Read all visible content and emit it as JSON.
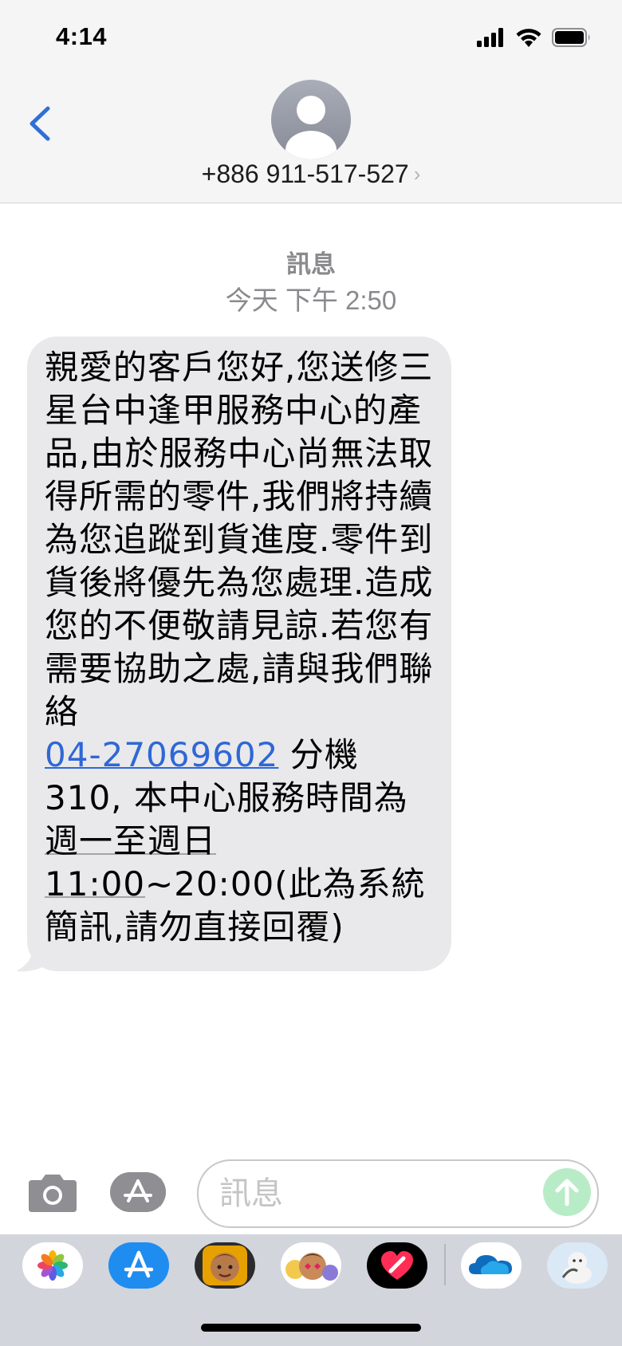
{
  "status_bar": {
    "time": "4:14"
  },
  "header": {
    "contact": "+886 911-517-527",
    "chevron": "›"
  },
  "thread": {
    "service_label": "訊息",
    "date_label": "今天 下午 2:50"
  },
  "message": {
    "part1": "親愛的客戶您好,您送修三星台中逢甲服務中心的產品,由於服務中心尚無法取得所需的零件,我們將持續為您追蹤到貨進度.零件到貨後將優先為您處理.造成您的不便敬請見諒.若您有需要協助之處,請與我們聯絡",
    "phone_link": "04-27069602",
    "part2": " 分機 310, 本中心服務時間為",
    "date_detected": "週一至週日11:00",
    "part3": "~20:00(此為系統簡訊,請勿直接回覆)"
  },
  "composer": {
    "placeholder": "訊息"
  },
  "app_strip": [
    {
      "name": "Photos",
      "icon": "photos-icon"
    },
    {
      "name": "App Store",
      "icon": "app-store-icon"
    },
    {
      "name": "Memoji",
      "icon": "memoji-icon"
    },
    {
      "name": "Memoji Stickers",
      "icon": "memoji-stickers-icon"
    },
    {
      "name": "Digital Touch",
      "icon": "digital-touch-icon"
    },
    {
      "name": "OneDrive",
      "icon": "onedrive-icon"
    },
    {
      "name": "Sticker App",
      "icon": "sticker-app-icon"
    }
  ],
  "colors": {
    "link": "#2f67d6",
    "bubble": "#e9e9eb",
    "send_button": "#b8ecc6",
    "back_chevron": "#2f6fd6"
  }
}
